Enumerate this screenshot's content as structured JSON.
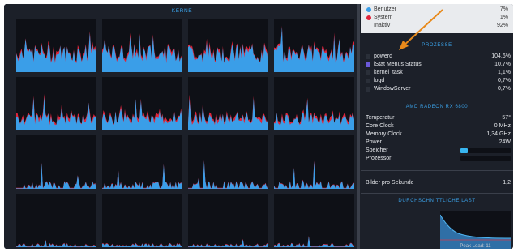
{
  "cores": {
    "title": "KERNE",
    "count": 16,
    "accent_user": "#3a9ee8",
    "accent_system": "#e0243a"
  },
  "legend": [
    {
      "label": "Benutzer",
      "value": "7%",
      "color": "#3a9ee8"
    },
    {
      "label": "System",
      "value": "1%",
      "color": "#e0243a"
    },
    {
      "label": "Inaktiv",
      "value": "92%",
      "color": ""
    }
  ],
  "processes": {
    "title": "PROZESSE",
    "items": [
      {
        "name": "powerd",
        "value": "104,6%"
      },
      {
        "name": "iStat Menus Status",
        "value": "10,7%"
      },
      {
        "name": "kernel_task",
        "value": "1,1%"
      },
      {
        "name": "logd",
        "value": "0,7%"
      },
      {
        "name": "WindowServer",
        "value": "0,7%"
      }
    ]
  },
  "gpu": {
    "title": "AMD RADEON RX 6800",
    "rows": [
      {
        "label": "Temperatur",
        "value": "57°"
      },
      {
        "label": "Core Clock",
        "value": "0 MHz"
      },
      {
        "label": "Memory Clock",
        "value": "1,34 GHz"
      },
      {
        "label": "Power",
        "value": "24W"
      }
    ],
    "memory_label": "Speicher",
    "memory_fraction": 0.15,
    "processor_label": "Prozessor",
    "processor_fraction": 0.0
  },
  "fps": {
    "label": "Bilder pro Sekunde",
    "value": "1,2"
  },
  "load": {
    "title": "DURCHSCHNITTLICHE LAST",
    "peak": "Peak Load: 11"
  }
}
